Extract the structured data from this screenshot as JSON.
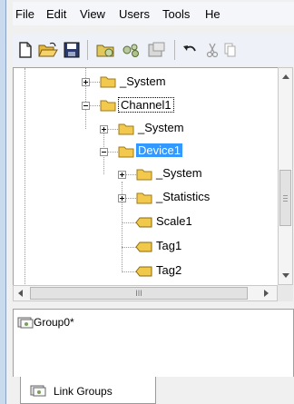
{
  "menu": {
    "items": [
      "File",
      "Edit",
      "View",
      "Users",
      "Tools",
      "He"
    ]
  },
  "toolbar": {
    "icons": [
      "new-icon",
      "open-icon",
      "save-icon",
      "channel-icon",
      "device-icon",
      "properties-icon",
      "undo-icon",
      "cut-icon",
      "copy-icon"
    ]
  },
  "tree": {
    "nodes": [
      {
        "label": "_System",
        "level": 1,
        "expander": "plus",
        "icon": "folder-icon"
      },
      {
        "label": "Channel1",
        "level": 1,
        "expander": "minus",
        "icon": "folder-icon",
        "focused": true
      },
      {
        "label": "_System",
        "level": 2,
        "expander": "plus",
        "icon": "folder-icon"
      },
      {
        "label": "Device1",
        "level": 2,
        "expander": "minus",
        "icon": "folder-icon",
        "selected": true
      },
      {
        "label": "_System",
        "level": 3,
        "expander": "plus",
        "icon": "folder-icon"
      },
      {
        "label": "_Statistics",
        "level": 3,
        "expander": "plus",
        "icon": "folder-icon"
      },
      {
        "label": "Scale1",
        "level": 3,
        "expander": "none",
        "icon": "tag-icon"
      },
      {
        "label": "Tag1",
        "level": 3,
        "expander": "none",
        "icon": "tag-icon"
      },
      {
        "label": "Tag2",
        "level": 3,
        "expander": "none",
        "icon": "tag-icon"
      }
    ]
  },
  "hscroll": {
    "thumb_label": "III"
  },
  "groups_panel": {
    "item_label": "Group0*"
  },
  "tabs": {
    "link_groups_label": "Link Groups"
  },
  "colors": {
    "selection": "#3399ff",
    "folder": "#f2c94c",
    "tag": "#f0c84a"
  }
}
